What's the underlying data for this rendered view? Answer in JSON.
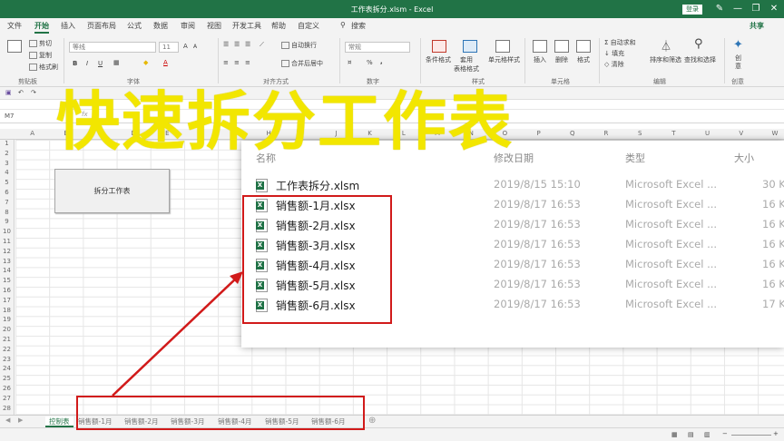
{
  "window": {
    "title": "工作表拆分.xlsm - Excel",
    "login_label": "登录",
    "minimize": "—",
    "restore": "❐",
    "close": "✕"
  },
  "ribbon_tabs": [
    "文件",
    "开始",
    "插入",
    "页面布局",
    "公式",
    "数据",
    "审阅",
    "视图",
    "开发工具",
    "帮助",
    "自定义",
    "搜索"
  ],
  "share_label": "共享",
  "ribbon": {
    "clipboard": {
      "cut": "剪切",
      "copy": "复制",
      "format_painter": "格式刷",
      "group": "剪贴板"
    },
    "font": {
      "name": "等线",
      "size": "11",
      "group": "字体",
      "bold": "B",
      "italic": "I",
      "underline": "U",
      "font_color_a": "A",
      "grow": "A",
      "shrink": "A"
    },
    "alignment": {
      "wrap": "自动换行",
      "merge": "合并后居中",
      "group": "对齐方式"
    },
    "number": {
      "format": "常规",
      "percent": "%",
      "comma": ",",
      "group": "数字"
    },
    "styles": {
      "cond": "条件格式",
      "table": "套用\n表格格式",
      "cell": "单元格样式",
      "group": "样式"
    },
    "cells": {
      "insert": "插入",
      "delete": "删除",
      "format": "格式",
      "group": "单元格"
    },
    "editing": {
      "autosum": "自动求和",
      "fill": "填充",
      "clear": "清除",
      "sort": "排序和筛选",
      "find": "查找和选择",
      "group": "编辑"
    },
    "ideas": {
      "label": "创\n意",
      "group": "创意"
    }
  },
  "name_box": "M7",
  "columns": [
    "A",
    "B",
    "C",
    "D",
    "E",
    "F",
    "G",
    "H",
    "I",
    "J",
    "K",
    "L",
    "M",
    "N",
    "O",
    "P",
    "Q",
    "R",
    "S",
    "T",
    "U",
    "V",
    "W"
  ],
  "rows": [
    "1",
    "2",
    "3",
    "4",
    "5",
    "6",
    "7",
    "8",
    "9",
    "10",
    "11",
    "12",
    "13",
    "14",
    "15",
    "16",
    "17",
    "18",
    "19",
    "20",
    "21",
    "22",
    "23",
    "24",
    "25",
    "26",
    "27",
    "28"
  ],
  "macro_button": "拆分工作表",
  "overlay_title": "快速拆分工作表",
  "explorer": {
    "headers": {
      "name": "名称",
      "date": "修改日期",
      "type": "类型",
      "size": "大小"
    },
    "files": [
      {
        "name": "工作表拆分.xlsm",
        "date": "2019/8/15 15:10",
        "type": "Microsoft Excel ...",
        "size": "30 K"
      },
      {
        "name": "销售额-1月.xlsx",
        "date": "2019/8/17 16:53",
        "type": "Microsoft Excel ...",
        "size": "16 K"
      },
      {
        "name": "销售额-2月.xlsx",
        "date": "2019/8/17 16:53",
        "type": "Microsoft Excel ...",
        "size": "16 K"
      },
      {
        "name": "销售额-3月.xlsx",
        "date": "2019/8/17 16:53",
        "type": "Microsoft Excel ...",
        "size": "16 K"
      },
      {
        "name": "销售额-4月.xlsx",
        "date": "2019/8/17 16:53",
        "type": "Microsoft Excel ...",
        "size": "16 K"
      },
      {
        "name": "销售额-5月.xlsx",
        "date": "2019/8/17 16:53",
        "type": "Microsoft Excel ...",
        "size": "16 K"
      },
      {
        "name": "销售额-6月.xlsx",
        "date": "2019/8/17 16:53",
        "type": "Microsoft Excel ...",
        "size": "17 K"
      }
    ]
  },
  "sheet_tabs": [
    "控制表",
    "销售额-1月",
    "销售额-2月",
    "销售额-3月",
    "销售额-4月",
    "销售额-5月",
    "销售额-6月"
  ],
  "add_sheet": "⊕",
  "colors": {
    "excel_green": "#217346",
    "highlight_red": "#d11a1a",
    "overlay_yellow": "#f2e600"
  }
}
